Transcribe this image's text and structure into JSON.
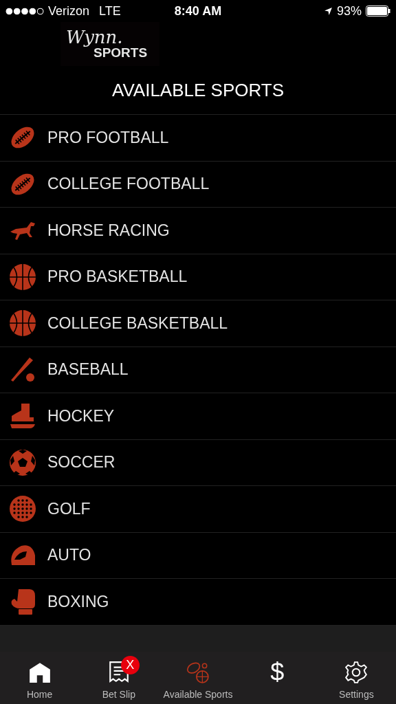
{
  "status_bar": {
    "carrier": "Verizon",
    "network": "LTE",
    "time": "8:40 AM",
    "battery": "93%"
  },
  "logo": {
    "script": "Wynn.",
    "word": "SPORTS"
  },
  "title": "AVAILABLE SPORTS",
  "sports": [
    {
      "label": "PRO FOOTBALL",
      "kind": "football"
    },
    {
      "label": "COLLEGE FOOTBALL",
      "kind": "football"
    },
    {
      "label": "HORSE RACING",
      "kind": "horse"
    },
    {
      "label": "PRO BASKETBALL",
      "kind": "basketball"
    },
    {
      "label": "COLLEGE BASKETBALL",
      "kind": "basketball"
    },
    {
      "label": "BASEBALL",
      "kind": "baseball"
    },
    {
      "label": "HOCKEY",
      "kind": "hockey"
    },
    {
      "label": "SOCCER",
      "kind": "soccer"
    },
    {
      "label": "GOLF",
      "kind": "golf"
    },
    {
      "label": "AUTO",
      "kind": "auto"
    },
    {
      "label": "BOXING",
      "kind": "boxing"
    }
  ],
  "tabs": [
    {
      "kind": "home",
      "label": "Home",
      "selected": false
    },
    {
      "kind": "slip",
      "label": "Bet Slip",
      "badge": "X",
      "selected": false
    },
    {
      "kind": "sports",
      "label": "Available Sports",
      "selected": true
    },
    {
      "kind": "dollar",
      "glyph": "$",
      "selected": false
    },
    {
      "kind": "settings",
      "label": "Settings",
      "selected": false
    }
  ]
}
